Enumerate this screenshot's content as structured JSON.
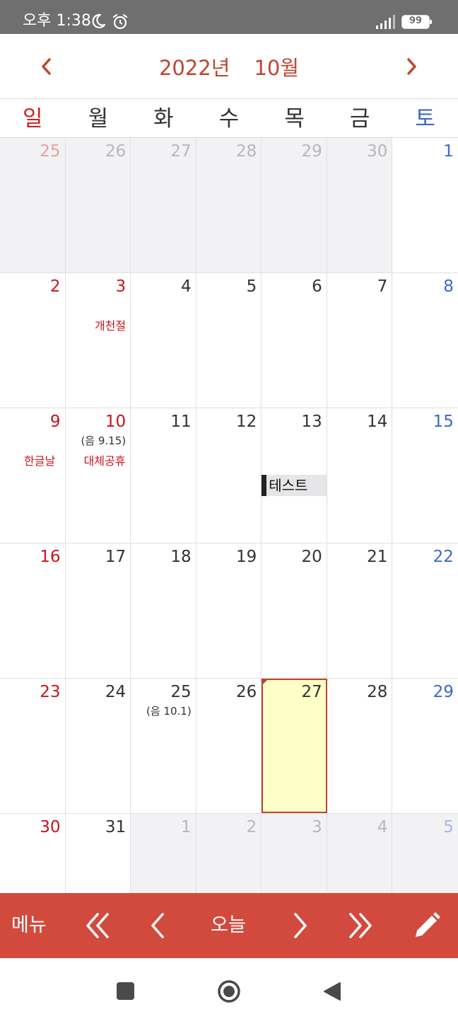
{
  "status": {
    "time": "오후 1:38",
    "battery": "99"
  },
  "header": {
    "year": "2022년",
    "month": "10월"
  },
  "weekdays": [
    "일",
    "월",
    "화",
    "수",
    "목",
    "금",
    "토"
  ],
  "weeks": [
    {
      "days": [
        {
          "num": "25",
          "note": "",
          "holiday": "",
          "event": ""
        },
        {
          "num": "26",
          "note": "",
          "holiday": "",
          "event": ""
        },
        {
          "num": "27",
          "note": "",
          "holiday": "",
          "event": ""
        },
        {
          "num": "28",
          "note": "",
          "holiday": "",
          "event": ""
        },
        {
          "num": "29",
          "note": "",
          "holiday": "",
          "event": ""
        },
        {
          "num": "30",
          "note": "",
          "holiday": "",
          "event": ""
        },
        {
          "num": "1",
          "note": "",
          "holiday": "",
          "event": ""
        }
      ]
    },
    {
      "days": [
        {
          "num": "2",
          "note": "",
          "holiday": "",
          "event": ""
        },
        {
          "num": "3",
          "note": "",
          "holiday": "개천절",
          "event": ""
        },
        {
          "num": "4",
          "note": "",
          "holiday": "",
          "event": ""
        },
        {
          "num": "5",
          "note": "",
          "holiday": "",
          "event": ""
        },
        {
          "num": "6",
          "note": "",
          "holiday": "",
          "event": ""
        },
        {
          "num": "7",
          "note": "",
          "holiday": "",
          "event": ""
        },
        {
          "num": "8",
          "note": "",
          "holiday": "",
          "event": ""
        }
      ]
    },
    {
      "days": [
        {
          "num": "9",
          "note": "",
          "holiday": "한글날",
          "event": ""
        },
        {
          "num": "10",
          "note": "(음 9.15)",
          "holiday": "대체공휴",
          "event": ""
        },
        {
          "num": "11",
          "note": "",
          "holiday": "",
          "event": ""
        },
        {
          "num": "12",
          "note": "",
          "holiday": "",
          "event": ""
        },
        {
          "num": "13",
          "note": "",
          "holiday": "",
          "event": "테스트"
        },
        {
          "num": "14",
          "note": "",
          "holiday": "",
          "event": ""
        },
        {
          "num": "15",
          "note": "",
          "holiday": "",
          "event": ""
        }
      ]
    },
    {
      "days": [
        {
          "num": "16",
          "note": "",
          "holiday": "",
          "event": ""
        },
        {
          "num": "17",
          "note": "",
          "holiday": "",
          "event": ""
        },
        {
          "num": "18",
          "note": "",
          "holiday": "",
          "event": ""
        },
        {
          "num": "19",
          "note": "",
          "holiday": "",
          "event": ""
        },
        {
          "num": "20",
          "note": "",
          "holiday": "",
          "event": ""
        },
        {
          "num": "21",
          "note": "",
          "holiday": "",
          "event": ""
        },
        {
          "num": "22",
          "note": "",
          "holiday": "",
          "event": ""
        }
      ]
    },
    {
      "days": [
        {
          "num": "23",
          "note": "",
          "holiday": "",
          "event": ""
        },
        {
          "num": "24",
          "note": "",
          "holiday": "",
          "event": ""
        },
        {
          "num": "25",
          "note": "(음 10.1)",
          "holiday": "",
          "event": ""
        },
        {
          "num": "26",
          "note": "",
          "holiday": "",
          "event": ""
        },
        {
          "num": "27",
          "note": "",
          "holiday": "",
          "event": ""
        },
        {
          "num": "28",
          "note": "",
          "holiday": "",
          "event": ""
        },
        {
          "num": "29",
          "note": "",
          "holiday": "",
          "event": ""
        }
      ]
    },
    {
      "days": [
        {
          "num": "30",
          "note": "",
          "holiday": "",
          "event": ""
        },
        {
          "num": "31",
          "note": "",
          "holiday": "",
          "event": ""
        },
        {
          "num": "1",
          "note": "",
          "holiday": "",
          "event": ""
        },
        {
          "num": "2",
          "note": "",
          "holiday": "",
          "event": ""
        },
        {
          "num": "3",
          "note": "",
          "holiday": "",
          "event": ""
        },
        {
          "num": "4",
          "note": "",
          "holiday": "",
          "event": ""
        },
        {
          "num": "5",
          "note": "",
          "holiday": "",
          "event": ""
        }
      ]
    }
  ],
  "toolbar": {
    "menu": "메뉴",
    "today": "오늘"
  },
  "colors": {
    "accent": "#c0442f",
    "toolbar": "#d24a3d",
    "sunday": "#c8141c",
    "saturday": "#3d68c7",
    "today_fill": "#ffffc8"
  },
  "icons": [
    "moon-icon",
    "alarm-icon",
    "signal-icon",
    "battery-icon",
    "chevron-left-icon",
    "chevron-right-icon",
    "double-chevron-left-icon",
    "double-chevron-right-icon",
    "pencil-icon",
    "square-icon",
    "home-circle-icon",
    "back-triangle-icon"
  ]
}
